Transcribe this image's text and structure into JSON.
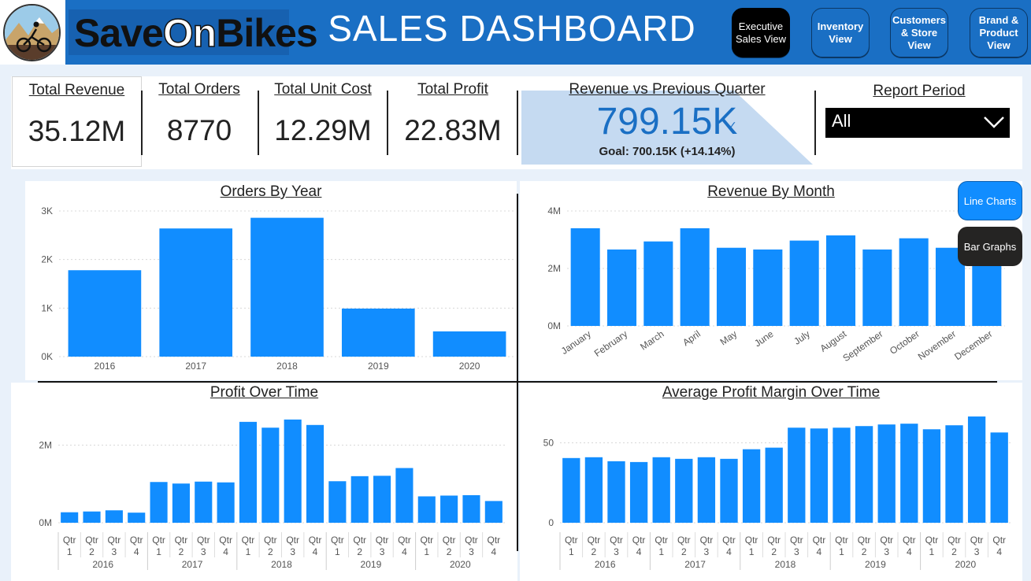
{
  "header": {
    "brand_part1": "Save",
    "brand_part2": "On",
    "brand_part3": "Bikes",
    "title": "SALES DASHBOARD",
    "nav": [
      {
        "line1": "Executive",
        "line2": "Sales View",
        "active": true
      },
      {
        "line1": "Inventory",
        "line2": "View",
        "active": false
      },
      {
        "line1": "Customers",
        "line2": "& Store",
        "line3": "View",
        "active": false
      },
      {
        "line1": "Brand &",
        "line2": "Product",
        "line3": "View",
        "active": false
      }
    ]
  },
  "kpis": {
    "total_revenue": {
      "label": "Total Revenue",
      "value": "35.12M"
    },
    "total_orders": {
      "label": "Total Orders",
      "value": "8770"
    },
    "total_unit_cost": {
      "label": "Total Unit Cost",
      "value": "12.29M"
    },
    "total_profit": {
      "label": "Total Profit",
      "value": "22.83M"
    }
  },
  "revenue_vs_prev": {
    "label": "Revenue vs Previous Quarter",
    "value": "799.15K",
    "goal_text": "Goal: 700.15K (+14.14%)",
    "progress_fraction": 1.1414
  },
  "report_period": {
    "label": "Report Period",
    "selected": "All"
  },
  "toggles": {
    "line_charts": "Line Charts",
    "bar_graphs": "Bar Graphs"
  },
  "colors": {
    "accent": "#118dff",
    "header": "#1a6fc4",
    "active_nav": "#000000"
  },
  "chart_data": [
    {
      "id": "orders_by_year",
      "type": "bar",
      "title": "Orders By Year",
      "categories": [
        "2016",
        "2017",
        "2018",
        "2019",
        "2020"
      ],
      "values": [
        1780,
        2640,
        2860,
        990,
        520
      ],
      "ylim": [
        0,
        3000
      ],
      "yticks": [
        0,
        1000,
        2000,
        3000
      ],
      "ytick_labels": [
        "0K",
        "1K",
        "2K",
        "3K"
      ],
      "grid": true
    },
    {
      "id": "revenue_by_month",
      "type": "bar",
      "title": "Revenue By Month",
      "categories": [
        "January",
        "February",
        "March",
        "April",
        "May",
        "June",
        "July",
        "August",
        "September",
        "October",
        "November",
        "December"
      ],
      "values": [
        3.4,
        2.66,
        2.94,
        3.4,
        2.72,
        2.66,
        2.97,
        3.15,
        2.66,
        3.05,
        2.72,
        2.69
      ],
      "ylim": [
        0,
        4
      ],
      "yticks": [
        0,
        2,
        4
      ],
      "ytick_labels": [
        "0M",
        "2M",
        "4M"
      ],
      "grid": true
    },
    {
      "id": "profit_over_time",
      "type": "bar",
      "title": "Profit Over Time",
      "quarters": [
        "Qtr 1",
        "Qtr 2",
        "Qtr 3",
        "Qtr 4"
      ],
      "years": [
        "2016",
        "2017",
        "2018",
        "2019",
        "2020"
      ],
      "values": [
        0.27,
        0.29,
        0.32,
        0.26,
        1.05,
        1.01,
        1.06,
        1.04,
        2.6,
        2.45,
        2.66,
        2.52,
        1.07,
        1.2,
        1.21,
        1.41,
        0.68,
        0.7,
        0.71,
        0.56
      ],
      "ylim": [
        0,
        2.8
      ],
      "yticks": [
        0,
        2
      ],
      "ytick_labels": [
        "0M",
        "2M"
      ],
      "grid": true
    },
    {
      "id": "avg_profit_margin_over_time",
      "type": "bar",
      "title": "Average Profit Margin Over Time",
      "quarters": [
        "Qtr 1",
        "Qtr 2",
        "Qtr 3",
        "Qtr 4"
      ],
      "years": [
        "2016",
        "2017",
        "2018",
        "2019",
        "2020"
      ],
      "values": [
        40.5,
        41,
        38.5,
        38,
        41,
        40,
        41,
        40,
        46,
        47,
        59.5,
        59,
        59.5,
        60.5,
        61.5,
        62,
        58.5,
        61,
        66.5,
        56.5
      ],
      "ylim": [
        0,
        68
      ],
      "yticks": [
        0,
        50
      ],
      "ytick_labels": [
        "0",
        "50"
      ],
      "grid": true
    }
  ]
}
